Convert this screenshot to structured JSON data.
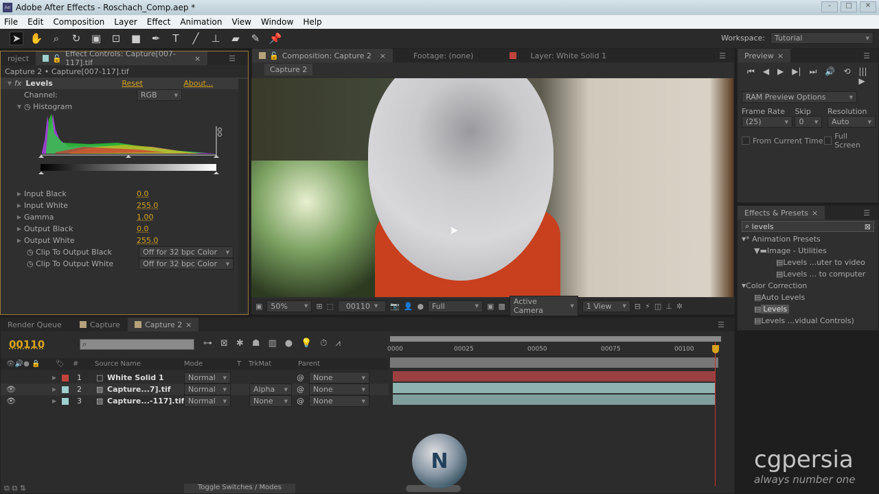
{
  "window": {
    "title": "Adobe After Effects - Roschach_Comp.aep *",
    "app_icon": "Ae"
  },
  "menu": [
    "File",
    "Edit",
    "Composition",
    "Layer",
    "Effect",
    "Animation",
    "View",
    "Window",
    "Help"
  ],
  "toolbar": {
    "tools": [
      "selection-tool",
      "hand-tool",
      "zoom-tool",
      "rotation-tool",
      "camera-tool",
      "pan-behind-tool",
      "rectangle-tool",
      "pen-tool",
      "type-tool",
      "brush-tool",
      "clone-stamp-tool",
      "eraser-tool",
      "roto-brush-tool",
      "puppet-pin-tool"
    ],
    "workspace_label": "Workspace:",
    "workspace_value": "Tutorial"
  },
  "left_panel": {
    "tabs": [
      "roject",
      "Effect Controls: Capture[007-117].tif"
    ],
    "breadcrumb": "Capture 2 • Capture[007-117].tif",
    "effect": {
      "name": "Levels",
      "reset": "Reset",
      "about": "About...",
      "channel_label": "Channel:",
      "channel_value": "RGB",
      "histogram_label": "Histogram",
      "props": [
        {
          "label": "Input Black",
          "value": "0.0"
        },
        {
          "label": "Input White",
          "value": "255.0"
        },
        {
          "label": "Gamma",
          "value": "1.00"
        },
        {
          "label": "Output Black",
          "value": "0.0"
        },
        {
          "label": "Output White",
          "value": "255.0"
        }
      ],
      "clips": [
        {
          "label": "Clip To Output Black",
          "value": "Off for 32 bpc Color"
        },
        {
          "label": "Clip To Output White",
          "value": "Off for 32 bpc Color"
        }
      ]
    }
  },
  "comp_panel": {
    "tabs": [
      "Composition: Capture 2",
      "Footage: (none)",
      "Layer: White Solid 1"
    ],
    "subtab": "Capture 2",
    "bottom": {
      "zoom": "50%",
      "timecode": "00110",
      "resolution": "Full",
      "camera": "Active Camera",
      "views": "1 View"
    }
  },
  "preview": {
    "tab": "Preview",
    "ram_options": "RAM Preview Options",
    "frame_rate_label": "Frame Rate",
    "frame_rate": "(25)",
    "skip_label": "Skip",
    "skip": "0",
    "resolution_label": "Resolution",
    "resolution": "Auto",
    "from_current": "From Current Time",
    "full_screen": "Full Screen"
  },
  "effects_presets": {
    "tab": "Effects & Presets",
    "search": "levels",
    "tree": [
      {
        "label": "* Animation Presets",
        "level": 0
      },
      {
        "label": "Image - Utilities",
        "level": 1
      },
      {
        "label": "Levels ...uter to video",
        "level": 2
      },
      {
        "label": "Levels ... to computer",
        "level": 2
      },
      {
        "label": "Color Correction",
        "level": 0
      },
      {
        "label": "Auto Levels",
        "level": 1
      },
      {
        "label": "Levels",
        "level": 1,
        "selected": true
      },
      {
        "label": "Levels ...vidual Controls)",
        "level": 1
      }
    ]
  },
  "timeline": {
    "tabs": [
      "Render Queue",
      "Capture",
      "Capture 2"
    ],
    "timecode": "00110",
    "columns": {
      "source": "Source Name",
      "mode": "Mode",
      "t": "T",
      "trkmat": "TrkMat",
      "parent": "Parent",
      "num": "#"
    },
    "ruler": [
      "0000",
      "00025",
      "00050",
      "00075",
      "00100"
    ],
    "layers": [
      {
        "num": "1",
        "name": "White Solid 1",
        "mode": "Normal",
        "trkmat": "",
        "parent": "None",
        "color": "#c0443c",
        "bar": "#9a4040"
      },
      {
        "num": "2",
        "name": "Capture...7].tif",
        "mode": "Normal",
        "trkmat": "Alpha",
        "parent": "None",
        "color": "#9fcfcf",
        "bar": "#8fb3b0"
      },
      {
        "num": "3",
        "name": "Capture...-117].tif",
        "mode": "Normal",
        "trkmat": "None",
        "parent": "None",
        "color": "#9fcfcf",
        "bar": "#7f9e9c"
      }
    ],
    "toggle": "Toggle Switches / Modes"
  },
  "watermark": {
    "brand": "cgpersia",
    "tagline": "always number one"
  }
}
